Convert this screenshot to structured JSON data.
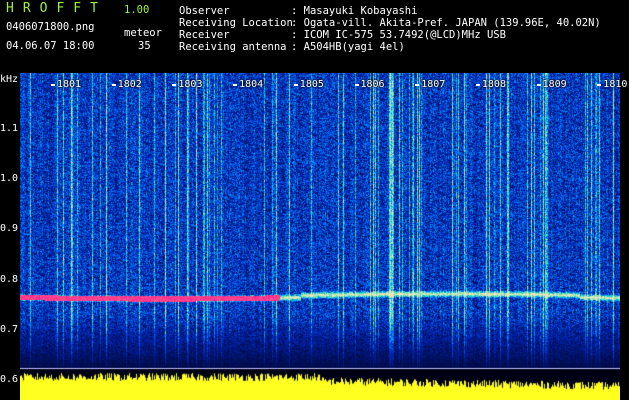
{
  "header": {
    "logo": "HROFFT",
    "version": "1.00",
    "filename": "0406071800.png",
    "datetime": "04.06.07 18:00",
    "meteor_label": "meteor",
    "meteor_count": "35",
    "observer_label": "Observer",
    "observer_value": ": Masayuki Kobayashi",
    "location_label": "Receiving Location",
    "location_value": ": Ogata-vill. Akita-Pref. JAPAN (139.96E, 40.02N)",
    "receiver_label": "Receiver",
    "receiver_value": ": ICOM IC-575 53.7492(@LCD)MHz USB",
    "antenna_label": "Receiving antenna",
    "antenna_value": ": A504HB(yagi 4el)"
  },
  "axis": {
    "unit": "kHz",
    "y_ticks": [
      "1.1",
      "1.0",
      "0.9",
      "0.8",
      "0.7",
      "0.6"
    ],
    "x_ticks": [
      "1801",
      "1802",
      "1803",
      "1804",
      "1805",
      "1806",
      "1807",
      "1808",
      "1809",
      "1810"
    ]
  },
  "colors": {
    "background": "#000000",
    "spectrum_low": "#0a1a7a",
    "spectrum_mid": "#1e5cff",
    "spectrum_high": "#40e0c0",
    "echo_line": "#ff2090",
    "meter": "#ffff20",
    "logo": "#9ff03c"
  }
}
